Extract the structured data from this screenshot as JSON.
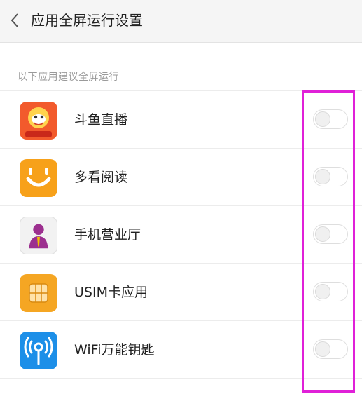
{
  "header": {
    "title": "应用全屏运行设置",
    "back_icon": "chevron-left-icon"
  },
  "section": {
    "label": "以下应用建议全屏运行"
  },
  "apps": [
    {
      "name": "斗鱼直播",
      "icon": "douyu-app-icon",
      "icon_text": "斗鱼直播",
      "enabled": false,
      "color": "#f25a2c"
    },
    {
      "name": "多看阅读",
      "icon": "duokan-app-icon",
      "enabled": false,
      "color": "#f7a11a"
    },
    {
      "name": "手机营业厅",
      "icon": "mobile-hall-app-icon",
      "enabled": false,
      "color": "#f2f2f2"
    },
    {
      "name": "USIM卡应用",
      "icon": "sim-card-app-icon",
      "enabled": false,
      "color": "#f5a623"
    },
    {
      "name": "WiFi万能钥匙",
      "icon": "wifi-key-app-icon",
      "enabled": false,
      "color": "#1d8fe8"
    }
  ],
  "highlight_color": "#e020d8"
}
